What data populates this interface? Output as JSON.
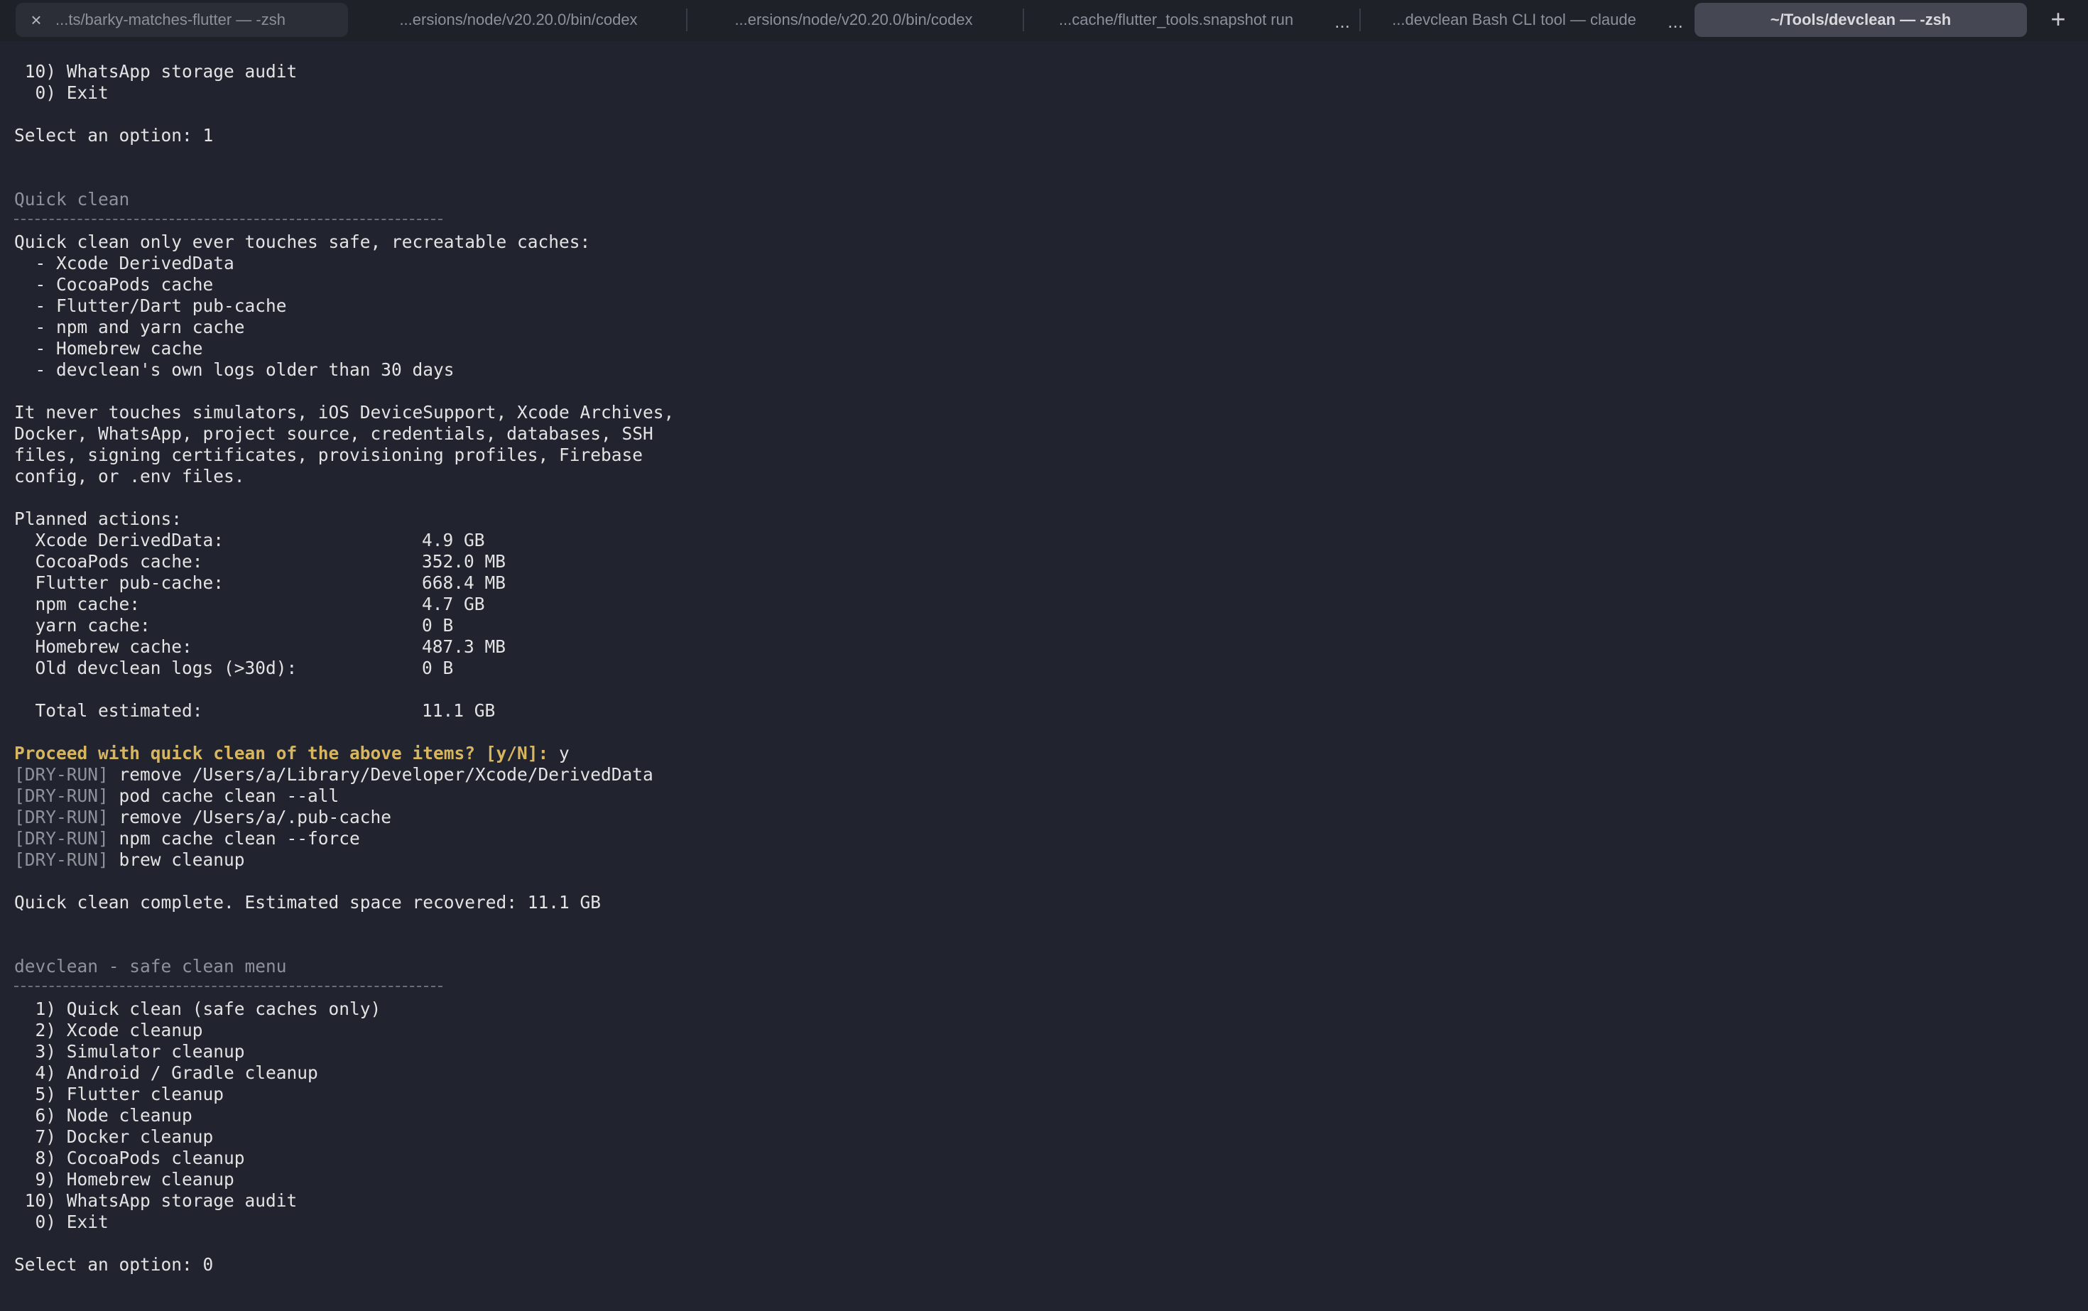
{
  "tabs": [
    {
      "label": "...ts/barky-matches-flutter — -zsh"
    },
    {
      "label": "...ersions/node/v20.20.0/bin/codex"
    },
    {
      "label": "...ersions/node/v20.20.0/bin/codex"
    },
    {
      "label": "...cache/flutter_tools.snapshot run"
    },
    {
      "label": "...devclean Bash CLI tool — claude"
    },
    {
      "label": "~/Tools/devclean — -zsh"
    }
  ],
  "tab_icons": {
    "close": "×",
    "more": "...",
    "new_tab": "+"
  },
  "terminal": {
    "top_menu_tail": [
      " 10) WhatsApp storage audit",
      "  0) Exit"
    ],
    "first_prompt": "Select an option: 1",
    "quick_clean_header": "Quick clean",
    "intro": "Quick clean only ever touches safe, recreatable caches:",
    "safe_items": [
      "  - Xcode DerivedData",
      "  - CocoaPods cache",
      "  - Flutter/Dart pub-cache",
      "  - npm and yarn cache",
      "  - Homebrew cache",
      "  - devclean's own logs older than 30 days"
    ],
    "never_touches": [
      "It never touches simulators, iOS DeviceSupport, Xcode Archives,",
      "Docker, WhatsApp, project source, credentials, databases, SSH",
      "files, signing certificates, provisioning profiles, Firebase",
      "config, or .env files."
    ],
    "planned_header": "Planned actions:",
    "planned_actions": [
      {
        "label": "  Xcode DerivedData:",
        "size": "4.9 GB"
      },
      {
        "label": "  CocoaPods cache:",
        "size": "352.0 MB"
      },
      {
        "label": "  Flutter pub-cache:",
        "size": "668.4 MB"
      },
      {
        "label": "  npm cache:",
        "size": "4.7 GB"
      },
      {
        "label": "  yarn cache:",
        "size": "0 B"
      },
      {
        "label": "  Homebrew cache:",
        "size": "487.3 MB"
      },
      {
        "label": "  Old devclean logs (>30d):",
        "size": "0 B"
      }
    ],
    "total": {
      "label": "  Total estimated:",
      "size": "11.1 GB"
    },
    "confirm_prompt": "Proceed with quick clean of the above items? [y/N]:",
    "confirm_answer": " y",
    "dry_run_tag": "[DRY-RUN]",
    "dry_run_commands": [
      " remove /Users/a/Library/Developer/Xcode/DerivedData",
      " pod cache clean --all",
      " remove /Users/a/.pub-cache",
      " npm cache clean --force",
      " brew cleanup"
    ],
    "complete_message": "Quick clean complete. Estimated space recovered: 11.1 GB",
    "menu_header": "devclean - safe clean menu",
    "menu_items": [
      "  1) Quick clean (safe caches only)",
      "  2) Xcode cleanup",
      "  3) Simulator cleanup",
      "  4) Android / Gradle cleanup",
      "  5) Flutter cleanup",
      "  6) Node cleanup",
      "  7) Docker cleanup",
      "  8) CocoaPods cleanup",
      "  9) Homebrew cleanup",
      " 10) WhatsApp storage audit",
      "  0) Exit"
    ],
    "final_prompt": "Select an option: 0"
  }
}
